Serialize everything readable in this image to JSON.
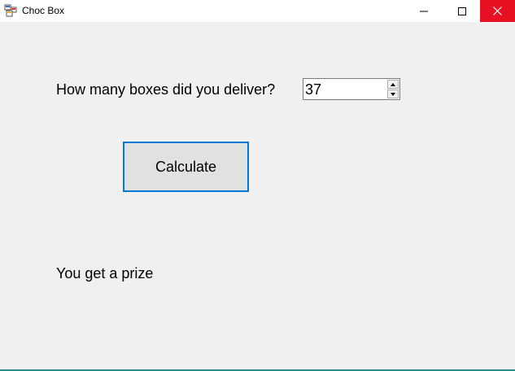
{
  "window": {
    "title": "Choc Box",
    "app_icon": "winforms-app-icon",
    "controls": {
      "minimize_icon": "minimize-icon",
      "maximize_icon": "maximize-icon",
      "close_icon": "close-icon"
    }
  },
  "form": {
    "question_label": "How many boxes did you deliver?",
    "boxes_input": {
      "value": "37"
    },
    "calculate_button_label": "Calculate",
    "result_label": "You get a prize"
  },
  "colors": {
    "close_button_bg": "#e81123",
    "button_focus_border": "#0078d7",
    "form_background": "#f0f0f0"
  }
}
